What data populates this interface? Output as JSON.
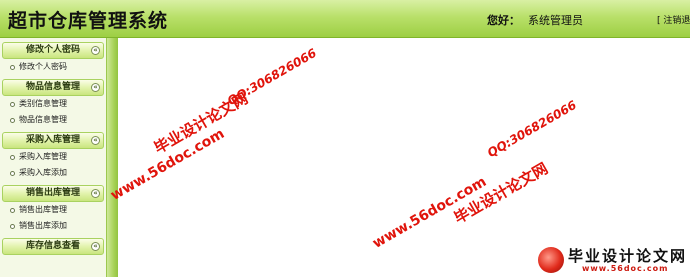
{
  "header": {
    "app_title": "超市仓库管理系统",
    "greeting": "您好：",
    "user_name": "系统管理员",
    "logout": "[ 注销退出"
  },
  "sidebar": {
    "toggle_symbol": "«",
    "groups": [
      {
        "title": "修改个人密码",
        "items": [
          "修改个人密码"
        ]
      },
      {
        "title": "物品信息管理",
        "items": [
          "类别信息管理",
          "物品信息管理"
        ]
      },
      {
        "title": "采购入库管理",
        "items": [
          "采购入库管理",
          "采购入库添加"
        ]
      },
      {
        "title": "销售出库管理",
        "items": [
          "销售出库管理",
          "销售出库添加"
        ]
      },
      {
        "title": "库存信息查看",
        "items": []
      }
    ]
  },
  "watermarks": {
    "brand_cn": "毕业设计论文网",
    "qq": "QQ:306826066",
    "url": "www.56doc.com"
  },
  "logo": {
    "text": "毕业设计论文网",
    "url": "www.56doc.com"
  },
  "colors": {
    "header_green": "#b9e06a",
    "accent_green": "#9dcf43",
    "watermark_red": "#e0140b"
  }
}
